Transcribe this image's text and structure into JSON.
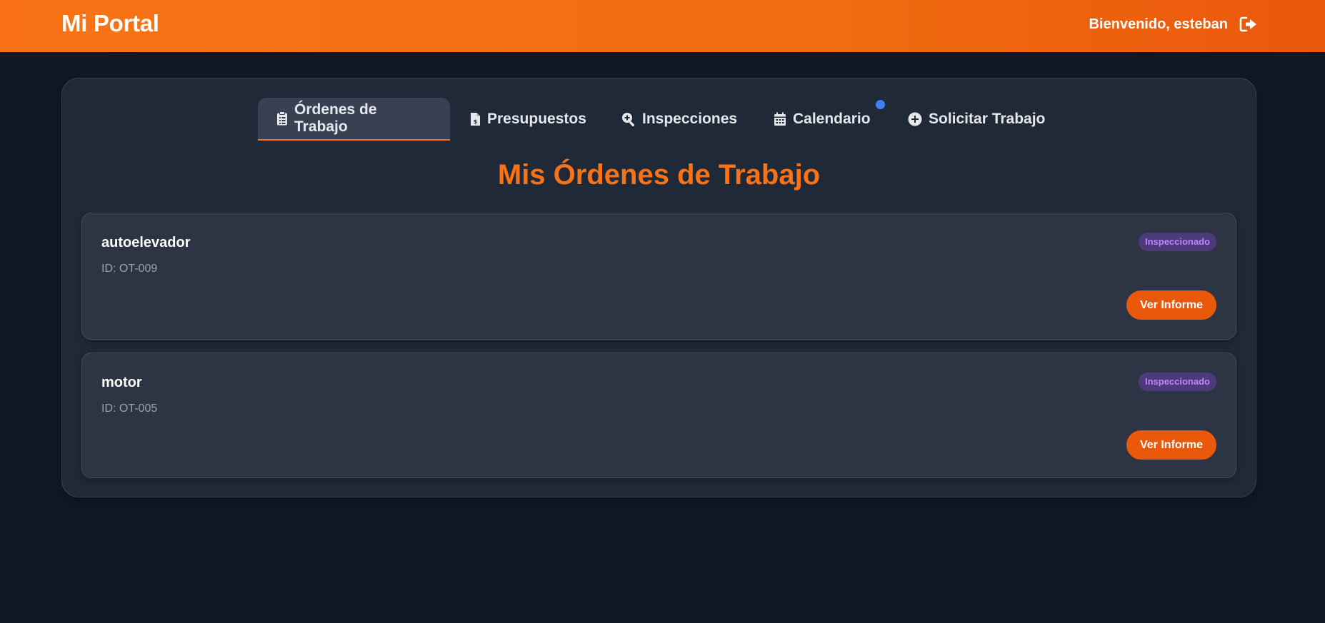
{
  "header": {
    "brand": "Mi Portal",
    "welcome": "Bienvenido, esteban",
    "logout_icon": "sign-out-icon"
  },
  "tabs": [
    {
      "label": "Órdenes de Trabajo",
      "icon": "clipboard-list-icon",
      "active": true
    },
    {
      "label": "Presupuestos",
      "icon": "file-invoice-dollar-icon",
      "active": false
    },
    {
      "label": "Inspecciones",
      "icon": "search-plus-icon",
      "active": false
    },
    {
      "label": "Calendario",
      "icon": "calendar-icon",
      "active": false,
      "notification_dot": true
    },
    {
      "label": "Solicitar Trabajo",
      "icon": "plus-circle-icon",
      "active": false
    }
  ],
  "main": {
    "title": "Mis Órdenes de Trabajo",
    "orders": [
      {
        "name": "autoelevador",
        "id": "ID: OT-009",
        "status": "Inspeccionado",
        "action": "Ver Informe"
      },
      {
        "name": "motor",
        "id": "ID: OT-005",
        "status": "Inspeccionado",
        "action": "Ver Informe"
      }
    ]
  },
  "colors": {
    "accent": "#f97316",
    "background": "#111827",
    "panel": "#1f2937",
    "card": "#2d3544",
    "badge_bg": "#4c3a7a",
    "badge_text": "#c084fc",
    "notification": "#3b82f6"
  }
}
